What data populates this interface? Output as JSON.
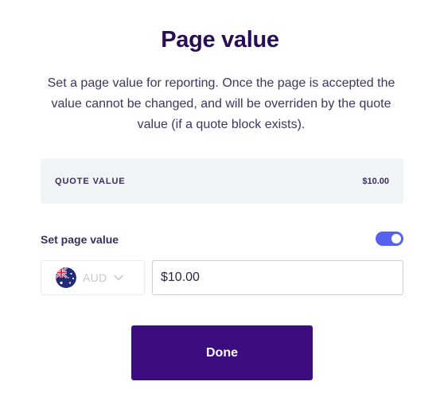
{
  "modal": {
    "title": "Page value",
    "description": "Set a page value for reporting. Once the page is accepted the value cannot be changed, and will be overriden by the quote value (if a quote block exists)."
  },
  "quote": {
    "label": "QUOTE VALUE",
    "amount": "$10.00"
  },
  "set_page_value": {
    "label": "Set page value",
    "toggle_on": true
  },
  "currency": {
    "code": "AUD",
    "flag_icon": "australia-flag-icon",
    "chevron_icon": "chevron-down-icon"
  },
  "amount_input": {
    "value": "$10.00"
  },
  "done_button": {
    "label": "Done"
  },
  "colors": {
    "title": "#2a0e55",
    "accent": "#3b0d7e",
    "toggle": "#5562eb",
    "quote_bg": "#f1f4f7"
  }
}
